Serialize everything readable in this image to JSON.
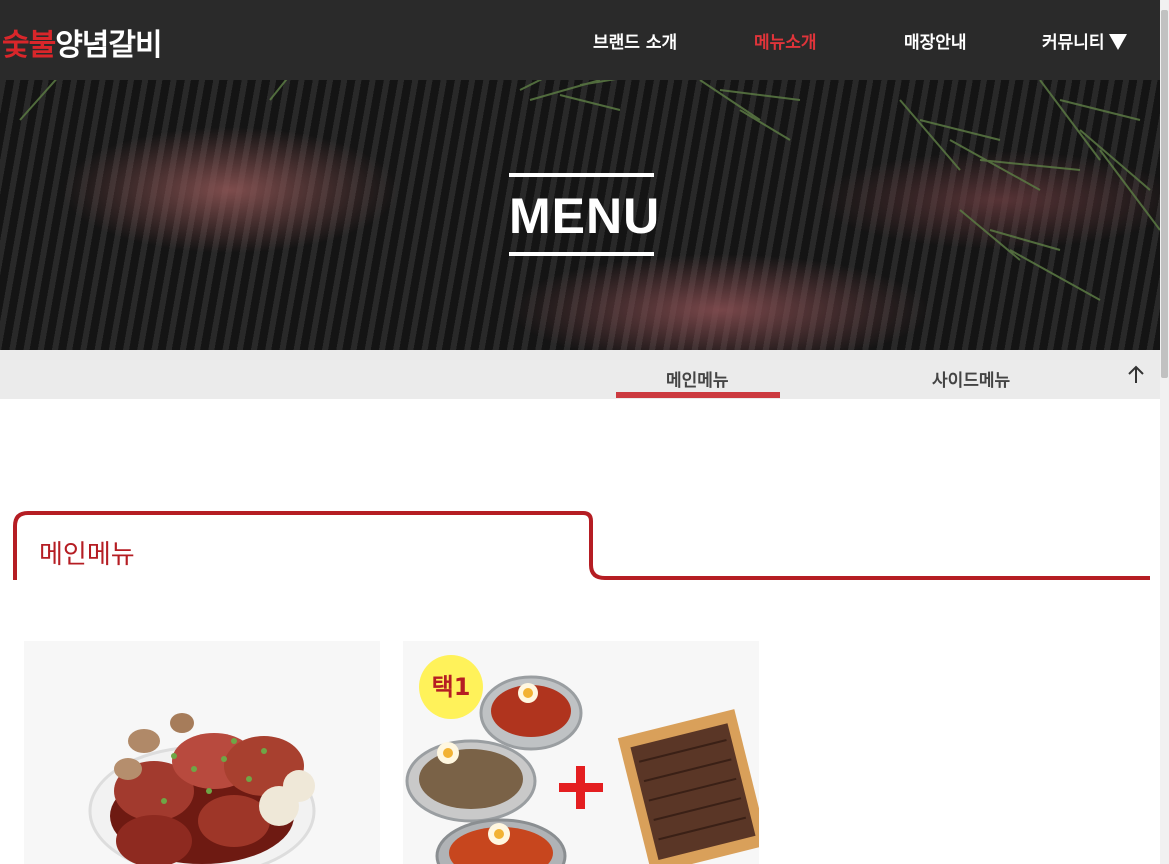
{
  "header": {
    "logo_part1": "숯불",
    "logo_part2": "양념갈비",
    "nav": [
      {
        "label": "브랜드 소개"
      },
      {
        "label": "메뉴소개"
      },
      {
        "label": "매장안내"
      },
      {
        "label": "커뮤니티"
      }
    ]
  },
  "hero": {
    "title": "MENU"
  },
  "subnav": {
    "tabs": [
      {
        "label": "메인메뉴"
      },
      {
        "label": "사이드메뉴"
      }
    ]
  },
  "section": {
    "title": "메인메뉴"
  },
  "cards": [
    {
      "badge": ""
    },
    {
      "badge": "택1"
    }
  ],
  "colors": {
    "accent_red": "#b51d23",
    "header_bg": "#2a2a2a",
    "active_nav": "#e0343a",
    "subnav_bg": "#ebebeb",
    "badge_yellow": "#fff25a"
  }
}
